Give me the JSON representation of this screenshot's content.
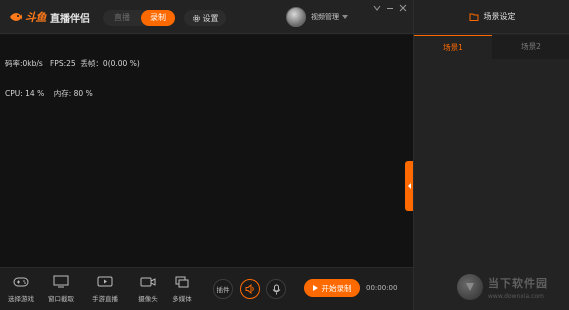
{
  "header": {
    "brand": "斗鱼",
    "app_name": "直播伴侣",
    "mode_live": "直播",
    "mode_record": "录制",
    "settings_label": "设置",
    "video_manage_label": "视频管理",
    "menu_icon": "menu-caret-icon",
    "minimize_icon": "minimize-icon",
    "close_icon": "close-icon"
  },
  "preview": {
    "stats_line1": "码率:0kb/s   FPS:25  丢帧：0(0.00 %)",
    "stats_line2": "CPU: 14 %    内存: 80 %"
  },
  "toolbar": {
    "items": [
      {
        "label": "选择游戏",
        "icon": "gamepad-icon"
      },
      {
        "label": "窗口截取",
        "icon": "monitor-icon"
      },
      {
        "label": "手游直播",
        "icon": "phone-play-icon"
      },
      {
        "label": "摄像头",
        "icon": "camera-icon"
      },
      {
        "label": "多媒体",
        "icon": "media-icon"
      }
    ],
    "plugin_label": "插件",
    "start_record_label": "开始录制",
    "timer": "00:00:00"
  },
  "scene_panel": {
    "title": "场景设定",
    "tabs": [
      "场景1",
      "场景2"
    ],
    "active_tab": 0
  },
  "watermark": {
    "name": "当下软件园",
    "url": "www.downxia.com"
  },
  "colors": {
    "accent": "#ff6a00",
    "background": "#161616",
    "panel": "#232323"
  }
}
